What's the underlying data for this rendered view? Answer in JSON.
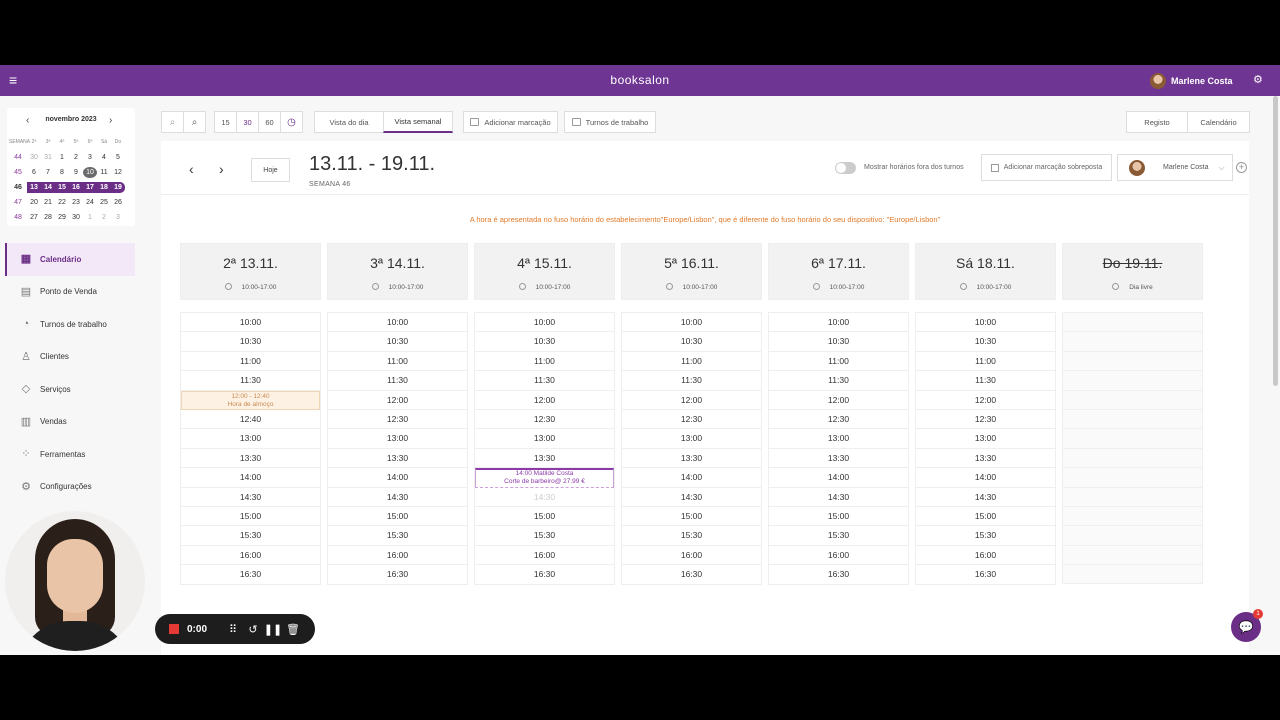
{
  "app": {
    "logo": "booksalon",
    "user": "Marlene Costa"
  },
  "mini_calendar": {
    "title": "novembro 2023",
    "week_label": "SEMANA",
    "dow": [
      "2ª",
      "3ª",
      "4ª",
      "5ª",
      "6ª",
      "Sá",
      "Do"
    ],
    "weeks": [
      {
        "wk": "44",
        "days": [
          "30",
          "31",
          "1",
          "2",
          "3",
          "4",
          "5"
        ]
      },
      {
        "wk": "45",
        "days": [
          "6",
          "7",
          "8",
          "9",
          "10",
          "11",
          "12"
        ]
      },
      {
        "wk": "46",
        "days": [
          "13",
          "14",
          "15",
          "16",
          "17",
          "18",
          "19"
        ]
      },
      {
        "wk": "47",
        "days": [
          "20",
          "21",
          "22",
          "23",
          "24",
          "25",
          "26"
        ]
      },
      {
        "wk": "48",
        "days": [
          "27",
          "28",
          "29",
          "30",
          "1",
          "2",
          "3"
        ]
      }
    ]
  },
  "nav": [
    {
      "label": "Calendário",
      "icon": "calendar-icon"
    },
    {
      "label": "Ponto de Venda",
      "icon": "cash-register-icon"
    },
    {
      "label": "Turnos de trabalho",
      "icon": "shifts-icon"
    },
    {
      "label": "Clientes",
      "icon": "clients-icon"
    },
    {
      "label": "Serviços",
      "icon": "diamond-icon"
    },
    {
      "label": "Vendas",
      "icon": "chart-icon"
    },
    {
      "label": "Ferramentas",
      "icon": "tools-icon"
    },
    {
      "label": "Configurações",
      "icon": "gear-icon"
    }
  ],
  "toolbar": {
    "intervals": [
      "15",
      "30",
      "60"
    ],
    "day_view": "Vista do dia",
    "week_view": "Vista semanal",
    "add_booking": "Adicionar marcação",
    "shifts": "Turnos de trabalho",
    "registo": "Registo",
    "calendario": "Calendário"
  },
  "header": {
    "today": "Hoje",
    "range": "13.11. - 19.11.",
    "week": "SEMANA 46",
    "show_off_hours": "Mostrar horários fora dos turnos",
    "overlay_booking": "Adicionar marcação sobreposta",
    "staff": "Marlene Costa"
  },
  "timezone_note": "A hora é apresentada no fuso horário do estabelecimento\"Europe/Lisbon\", que é diferente do fuso horário do seu dispositivo: \"Europe/Lisbon\"",
  "days": [
    {
      "name": "2ª 13.11.",
      "hours": "10:00-17:00"
    },
    {
      "name": "3ª 14.11.",
      "hours": "10:00-17:00"
    },
    {
      "name": "4ª 15.11.",
      "hours": "10:00-17:00"
    },
    {
      "name": "5ª 16.11.",
      "hours": "10:00-17:00"
    },
    {
      "name": "6ª 17.11.",
      "hours": "10:00-17:00"
    },
    {
      "name": "Sá 18.11.",
      "hours": "10:00-17:00"
    },
    {
      "name": "Do 19.11.",
      "hours": "Dia livre"
    }
  ],
  "slots": [
    "10:00",
    "10:30",
    "11:00",
    "11:30",
    "12:00",
    "12:30",
    "13:00",
    "13:30",
    "14:00",
    "14:30",
    "15:00",
    "15:30",
    "16:00",
    "16:30"
  ],
  "lunch": {
    "time": "12:00 - 12:40",
    "label": "Hora de almoço",
    "after": "12:40"
  },
  "appointment": {
    "line1": "14:00 Matilde Costa",
    "line2": "Corte de barbeiro@ 27.99 €"
  },
  "recorder": {
    "time": "0:00"
  },
  "chat_badge": "1"
}
